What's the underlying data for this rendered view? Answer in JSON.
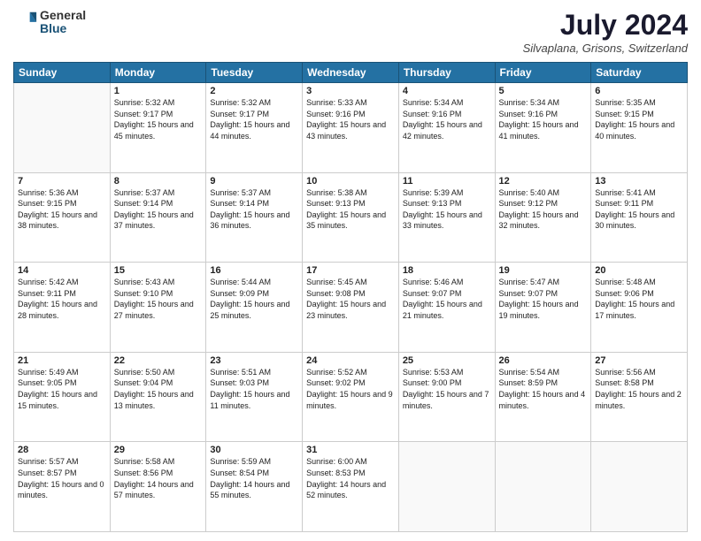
{
  "header": {
    "logo_general": "General",
    "logo_blue": "Blue",
    "month_year": "July 2024",
    "location": "Silvaplana, Grisons, Switzerland"
  },
  "days_of_week": [
    "Sunday",
    "Monday",
    "Tuesday",
    "Wednesday",
    "Thursday",
    "Friday",
    "Saturday"
  ],
  "weeks": [
    [
      {
        "day": "",
        "empty": true
      },
      {
        "day": "1",
        "sunrise": "5:32 AM",
        "sunset": "9:17 PM",
        "daylight": "15 hours and 45 minutes."
      },
      {
        "day": "2",
        "sunrise": "5:32 AM",
        "sunset": "9:17 PM",
        "daylight": "15 hours and 44 minutes."
      },
      {
        "day": "3",
        "sunrise": "5:33 AM",
        "sunset": "9:16 PM",
        "daylight": "15 hours and 43 minutes."
      },
      {
        "day": "4",
        "sunrise": "5:34 AM",
        "sunset": "9:16 PM",
        "daylight": "15 hours and 42 minutes."
      },
      {
        "day": "5",
        "sunrise": "5:34 AM",
        "sunset": "9:16 PM",
        "daylight": "15 hours and 41 minutes."
      },
      {
        "day": "6",
        "sunrise": "5:35 AM",
        "sunset": "9:15 PM",
        "daylight": "15 hours and 40 minutes."
      }
    ],
    [
      {
        "day": "7",
        "sunrise": "5:36 AM",
        "sunset": "9:15 PM",
        "daylight": "15 hours and 38 minutes."
      },
      {
        "day": "8",
        "sunrise": "5:37 AM",
        "sunset": "9:14 PM",
        "daylight": "15 hours and 37 minutes."
      },
      {
        "day": "9",
        "sunrise": "5:37 AM",
        "sunset": "9:14 PM",
        "daylight": "15 hours and 36 minutes."
      },
      {
        "day": "10",
        "sunrise": "5:38 AM",
        "sunset": "9:13 PM",
        "daylight": "15 hours and 35 minutes."
      },
      {
        "day": "11",
        "sunrise": "5:39 AM",
        "sunset": "9:13 PM",
        "daylight": "15 hours and 33 minutes."
      },
      {
        "day": "12",
        "sunrise": "5:40 AM",
        "sunset": "9:12 PM",
        "daylight": "15 hours and 32 minutes."
      },
      {
        "day": "13",
        "sunrise": "5:41 AM",
        "sunset": "9:11 PM",
        "daylight": "15 hours and 30 minutes."
      }
    ],
    [
      {
        "day": "14",
        "sunrise": "5:42 AM",
        "sunset": "9:11 PM",
        "daylight": "15 hours and 28 minutes."
      },
      {
        "day": "15",
        "sunrise": "5:43 AM",
        "sunset": "9:10 PM",
        "daylight": "15 hours and 27 minutes."
      },
      {
        "day": "16",
        "sunrise": "5:44 AM",
        "sunset": "9:09 PM",
        "daylight": "15 hours and 25 minutes."
      },
      {
        "day": "17",
        "sunrise": "5:45 AM",
        "sunset": "9:08 PM",
        "daylight": "15 hours and 23 minutes."
      },
      {
        "day": "18",
        "sunrise": "5:46 AM",
        "sunset": "9:07 PM",
        "daylight": "15 hours and 21 minutes."
      },
      {
        "day": "19",
        "sunrise": "5:47 AM",
        "sunset": "9:07 PM",
        "daylight": "15 hours and 19 minutes."
      },
      {
        "day": "20",
        "sunrise": "5:48 AM",
        "sunset": "9:06 PM",
        "daylight": "15 hours and 17 minutes."
      }
    ],
    [
      {
        "day": "21",
        "sunrise": "5:49 AM",
        "sunset": "9:05 PM",
        "daylight": "15 hours and 15 minutes."
      },
      {
        "day": "22",
        "sunrise": "5:50 AM",
        "sunset": "9:04 PM",
        "daylight": "15 hours and 13 minutes."
      },
      {
        "day": "23",
        "sunrise": "5:51 AM",
        "sunset": "9:03 PM",
        "daylight": "15 hours and 11 minutes."
      },
      {
        "day": "24",
        "sunrise": "5:52 AM",
        "sunset": "9:02 PM",
        "daylight": "15 hours and 9 minutes."
      },
      {
        "day": "25",
        "sunrise": "5:53 AM",
        "sunset": "9:00 PM",
        "daylight": "15 hours and 7 minutes."
      },
      {
        "day": "26",
        "sunrise": "5:54 AM",
        "sunset": "8:59 PM",
        "daylight": "15 hours and 4 minutes."
      },
      {
        "day": "27",
        "sunrise": "5:56 AM",
        "sunset": "8:58 PM",
        "daylight": "15 hours and 2 minutes."
      }
    ],
    [
      {
        "day": "28",
        "sunrise": "5:57 AM",
        "sunset": "8:57 PM",
        "daylight": "15 hours and 0 minutes."
      },
      {
        "day": "29",
        "sunrise": "5:58 AM",
        "sunset": "8:56 PM",
        "daylight": "14 hours and 57 minutes."
      },
      {
        "day": "30",
        "sunrise": "5:59 AM",
        "sunset": "8:54 PM",
        "daylight": "14 hours and 55 minutes."
      },
      {
        "day": "31",
        "sunrise": "6:00 AM",
        "sunset": "8:53 PM",
        "daylight": "14 hours and 52 minutes."
      },
      {
        "day": "",
        "empty": true
      },
      {
        "day": "",
        "empty": true
      },
      {
        "day": "",
        "empty": true
      }
    ]
  ]
}
